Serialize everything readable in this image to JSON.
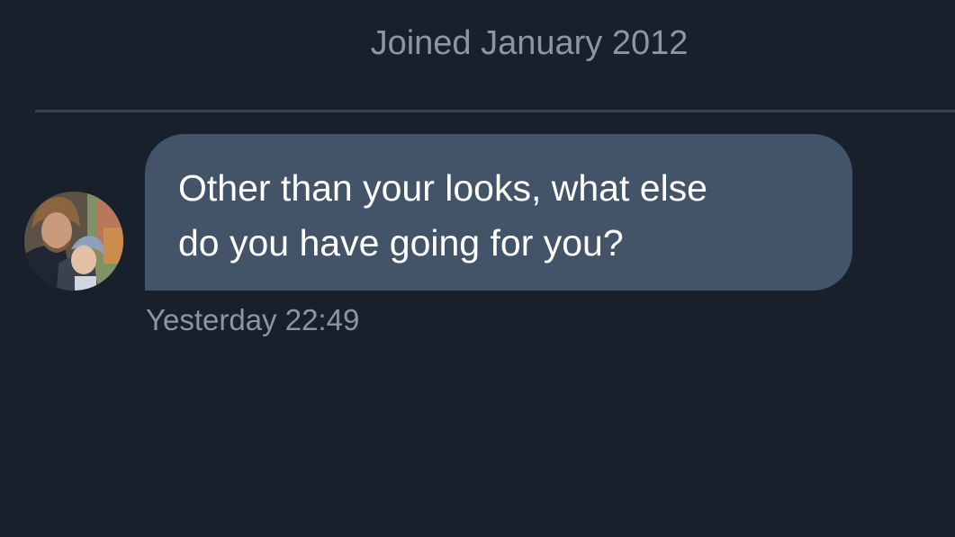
{
  "profile": {
    "joined_text": "Joined January 2012"
  },
  "conversation": {
    "messages": [
      {
        "text": "Other than your looks, what else\ndo you have going for you?",
        "timestamp": "Yesterday 22:49",
        "sender_avatar": "avatar-photo"
      }
    ]
  },
  "colors": {
    "background": "#18202c",
    "bubble": "#435468",
    "secondary_text": "#8c96a2",
    "divider": "#38414e"
  }
}
